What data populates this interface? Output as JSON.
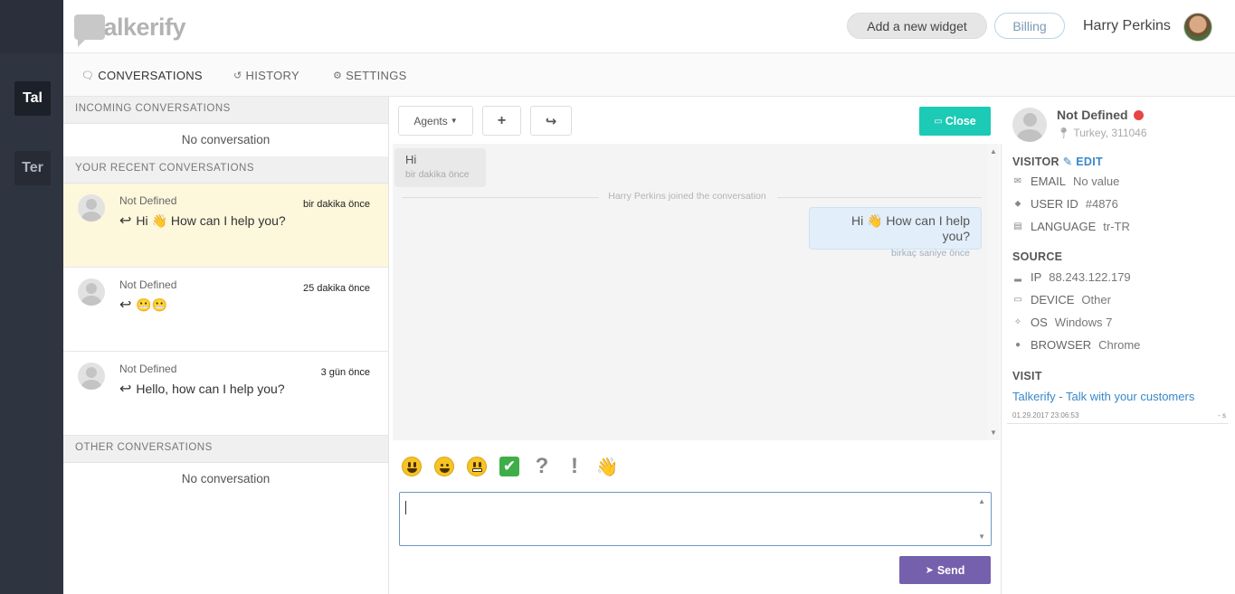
{
  "sidebar": {
    "workspaces": [
      {
        "label": "Tal"
      },
      {
        "label": "Ter"
      }
    ]
  },
  "header": {
    "logo_text": "talkerify",
    "add_widget_label": "Add a new widget",
    "billing_label": "Billing",
    "user_name": "Harry Perkins"
  },
  "tabs": [
    {
      "label": "CONVERSATIONS",
      "icon": "chat-icon"
    },
    {
      "label": "HISTORY",
      "icon": "history-icon"
    },
    {
      "label": "SETTINGS",
      "icon": "gear-icon"
    }
  ],
  "conversations": {
    "incoming_title": "INCOMING CONVERSATIONS",
    "incoming_empty": "No conversation",
    "recent_title": "YOUR RECENT CONVERSATIONS",
    "recent": [
      {
        "name": "Not Defined",
        "time": "bir dakika önce",
        "message": "Hi 👋 How can I help you?"
      },
      {
        "name": "Not Defined",
        "time": "25 dakika önce",
        "message": "😬😬"
      },
      {
        "name": "Not Defined",
        "time": "3 gün önce",
        "message": "Hello, how can I help you?"
      }
    ],
    "other_title": "OTHER CONVERSATIONS",
    "other_empty": "No conversation"
  },
  "chat": {
    "agents_label": "Agents",
    "plus_label": "+",
    "forward_label": "↪",
    "close_label": "Close",
    "messages": {
      "incoming_text": "Hi",
      "incoming_time": "bir dakika önce",
      "joined_notice": "Harry Perkins joined the conversation",
      "outgoing_text": "Hi 👋 How can I help you?",
      "outgoing_time": "birkaç saniye önce"
    },
    "emojis": [
      "smiley-icon",
      "smile-icon",
      "grimace-icon",
      "check-icon",
      "question-icon",
      "exclamation-icon",
      "wave-icon"
    ],
    "question_glyph": "?",
    "exclamation_glyph": "!",
    "wave_glyph": "👋",
    "check_glyph": "✔",
    "input_value": "",
    "send_label": "Send"
  },
  "visitor": {
    "name": "Not Defined",
    "status_color": "#e84545",
    "location": "Turkey, 311046",
    "visitor_title": "VISITOR",
    "edit_label": "EDIT",
    "email_label": "EMAIL",
    "email_value": "No value",
    "userid_label": "USER ID",
    "userid_value": "#4876",
    "language_label": "LANGUAGE",
    "language_value": "tr-TR",
    "source_title": "SOURCE",
    "ip_label": "IP",
    "ip_value": "88.243.122.179",
    "device_label": "DEVICE",
    "device_value": "Other",
    "os_label": "OS",
    "os_value": "Windows 7",
    "browser_label": "BROWSER",
    "browser_value": "Chrome",
    "visit_title": "VISIT",
    "visit_link": "Talkerify - Talk with your customers",
    "visit_time": "01.29.2017 23:06:53",
    "visit_duration": "- s"
  },
  "colors": {
    "accent_teal": "#1ccab5",
    "send_purple": "#7560ae",
    "link_blue": "#3a87c7",
    "sidebar_dark": "#2f3441"
  }
}
